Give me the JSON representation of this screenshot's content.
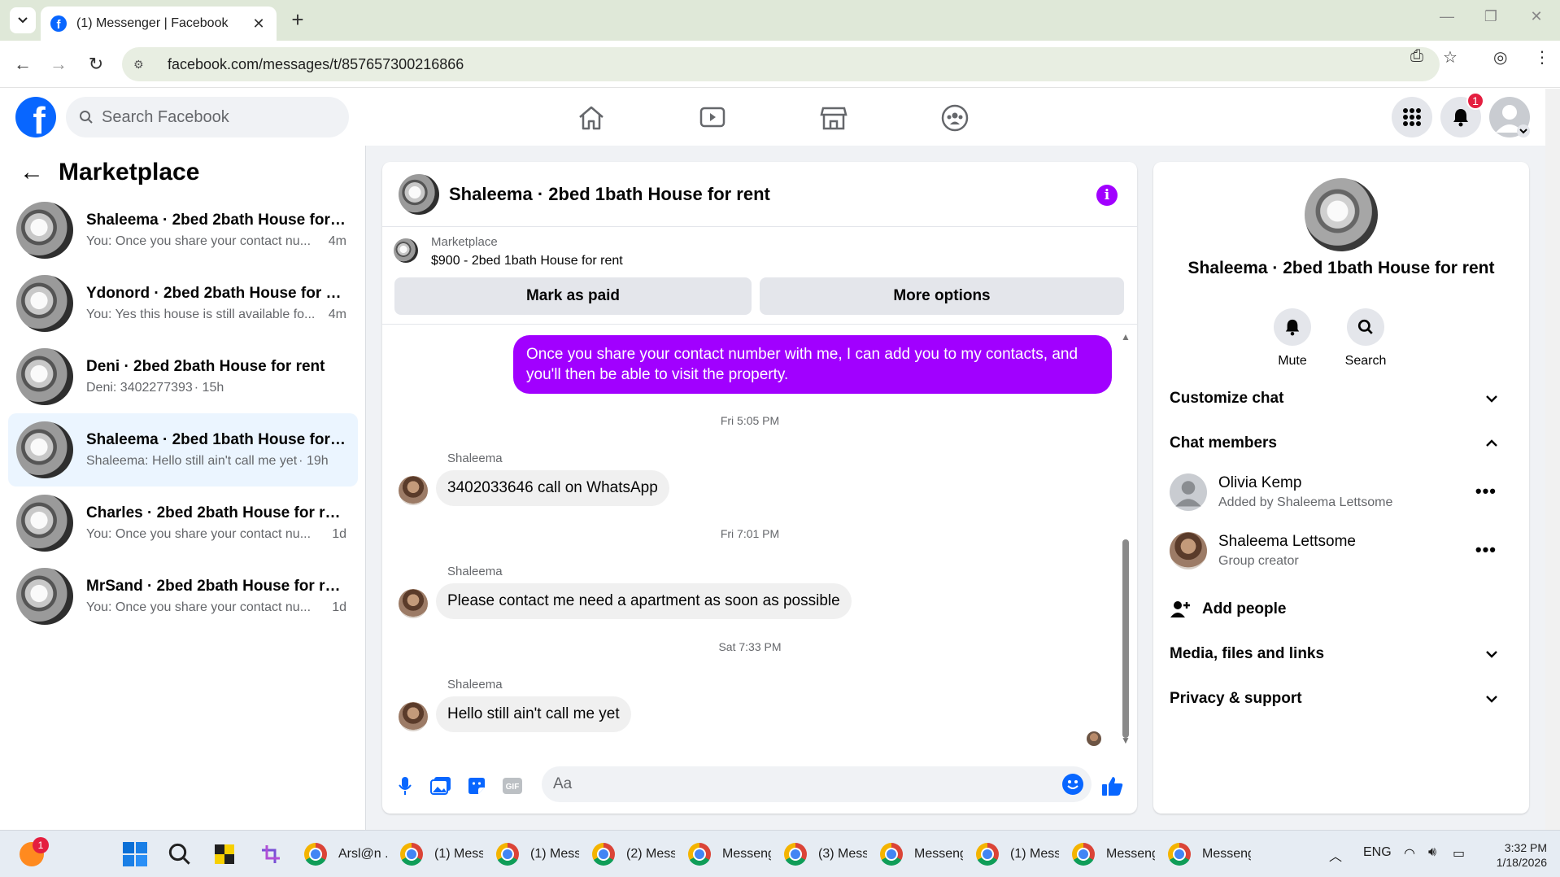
{
  "browser": {
    "tab_title": "(1) Messenger | Facebook",
    "url": "facebook.com/messages/t/857657300216866"
  },
  "fb": {
    "search_placeholder": "Search Facebook",
    "notification_count": "1",
    "colors": {
      "brand": "#0866ff",
      "accent": "#a100ff",
      "badge": "#e41e3f"
    }
  },
  "left": {
    "title": "Marketplace",
    "conversations": [
      {
        "name": "Shaleema · 2bed 2bath House for ...",
        "preview": "You: Once you share your contact nu...",
        "time": "4m"
      },
      {
        "name": "Ydonord · 2bed 2bath House for re...",
        "preview": "You: Yes this house is still available fo...",
        "time": "4m"
      },
      {
        "name": "Deni · 2bed 2bath House for rent",
        "preview": "Deni: 3402277393",
        "time": "· 15h"
      },
      {
        "name": "Shaleema · 2bed 1bath House for r...",
        "preview": "Shaleema: Hello still ain't call me yet",
        "time": "· 19h"
      },
      {
        "name": "Charles · 2bed 2bath House for rent",
        "preview": "You: Once you share your contact nu...",
        "time": "1d"
      },
      {
        "name": "MrSand · 2bed 2bath House for rent",
        "preview": "You: Once you share your contact nu...",
        "time": "1d"
      }
    ]
  },
  "chat": {
    "title": "Shaleema · 2bed 1bath House for rent",
    "listing_label": "Marketplace",
    "listing_price": "$900 - 2bed 1bath House for rent",
    "mark_paid": "Mark as paid",
    "more_options": "More options",
    "outgoing": "Once you share your contact number with me, I can add you to my contacts, and you'll then be able to visit the property.",
    "groups": [
      {
        "time": "Fri 5:05 PM",
        "sender": "Shaleema",
        "text": "3402033646 call on WhatsApp"
      },
      {
        "time": "Fri 7:01 PM",
        "sender": "Shaleema",
        "text": "Please contact me need a apartment as soon as possible"
      },
      {
        "time": "Sat 7:33 PM",
        "sender": "Shaleema",
        "text": "Hello still ain't call me yet"
      }
    ],
    "composer_placeholder": "Aa"
  },
  "right": {
    "name": "Shaleema · 2bed 1bath House for rent",
    "mute": "Mute",
    "search": "Search",
    "customize": "Customize chat",
    "members_title": "Chat members",
    "members": [
      {
        "name": "Olivia Kemp",
        "sub": "Added by Shaleema Lettsome"
      },
      {
        "name": "Shaleema Lettsome",
        "sub": "Group creator"
      }
    ],
    "add_people": "Add people",
    "media": "Media, files and links",
    "privacy": "Privacy & support"
  },
  "taskbar": {
    "start_badge": "1",
    "items": [
      "Arsl@n .",
      "(1) Mess",
      "(1) Mess",
      "(2) Mess",
      "Messeng",
      "(3) Mess",
      "Messeng",
      "(1) Mess",
      "Messeng",
      "Messeng"
    ],
    "lang": "ENG",
    "time": "3:32 PM",
    "date": "1/18/2026"
  }
}
